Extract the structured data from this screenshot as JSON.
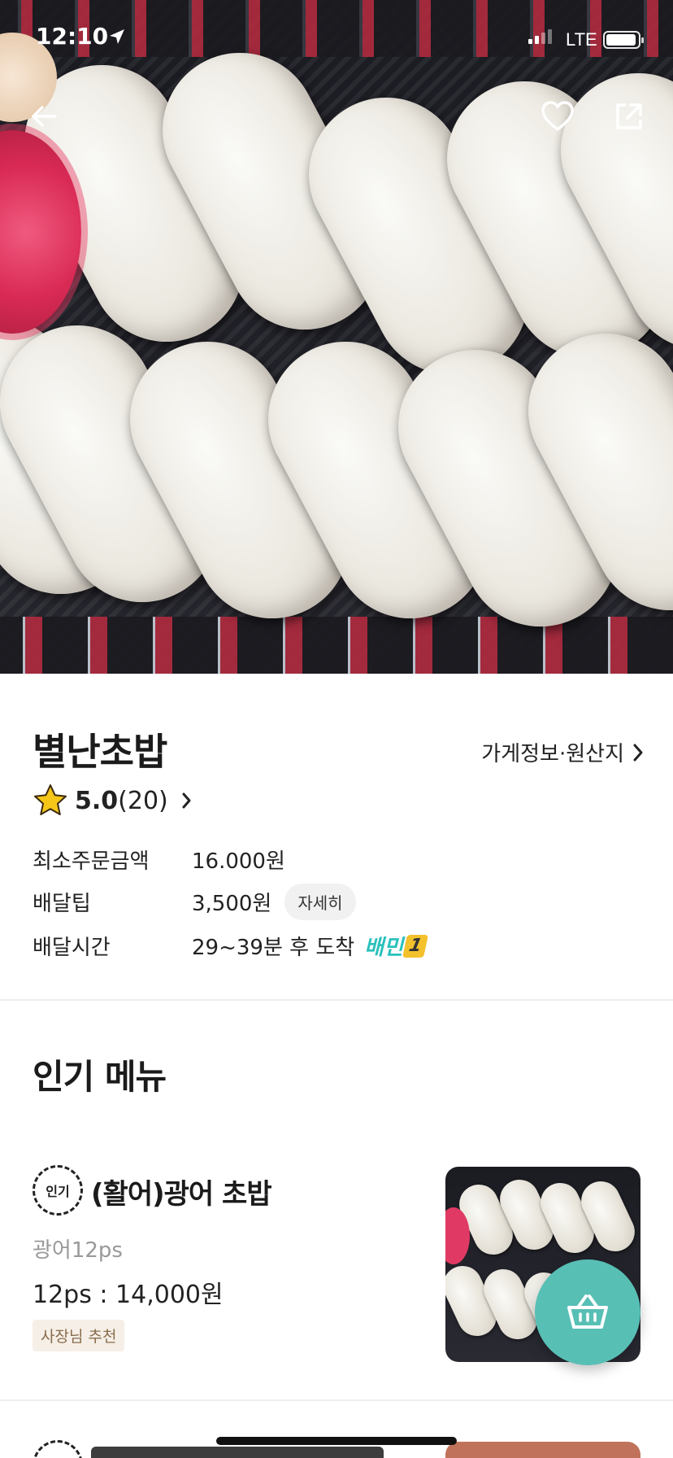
{
  "status_bar": {
    "time": "12:10",
    "network": "LTE"
  },
  "hero": {
    "back_icon": "arrow-left-icon",
    "favorite_icon": "heart-outline-icon",
    "share_icon": "share-icon"
  },
  "store": {
    "name": "별난초밥",
    "info_link": "가게정보·원산지",
    "rating": {
      "score": "5.0",
      "count": "(20)"
    },
    "details": [
      {
        "label": "최소주문금액",
        "value": "16.000원"
      },
      {
        "label": "배달팁",
        "value": "3,500원",
        "button": "자세히"
      },
      {
        "label": "배달시간",
        "value": "29~39분 후 도착",
        "badge": "배민",
        "badge_number": "1"
      }
    ]
  },
  "popular_menu": {
    "title": "인기 메뉴",
    "items": [
      {
        "badge": "인기",
        "name": "(활어)광어 초밥",
        "description": "광어12ps",
        "price": "12ps : 14,000원",
        "tag": "사장님 추천"
      }
    ]
  },
  "cart": {
    "icon": "basket-icon"
  },
  "colors": {
    "accent": "#2ac1bc",
    "cart_fab": "#58bfb5",
    "tag_bg": "#f5efe7",
    "tag_text": "#8a6d4d"
  }
}
